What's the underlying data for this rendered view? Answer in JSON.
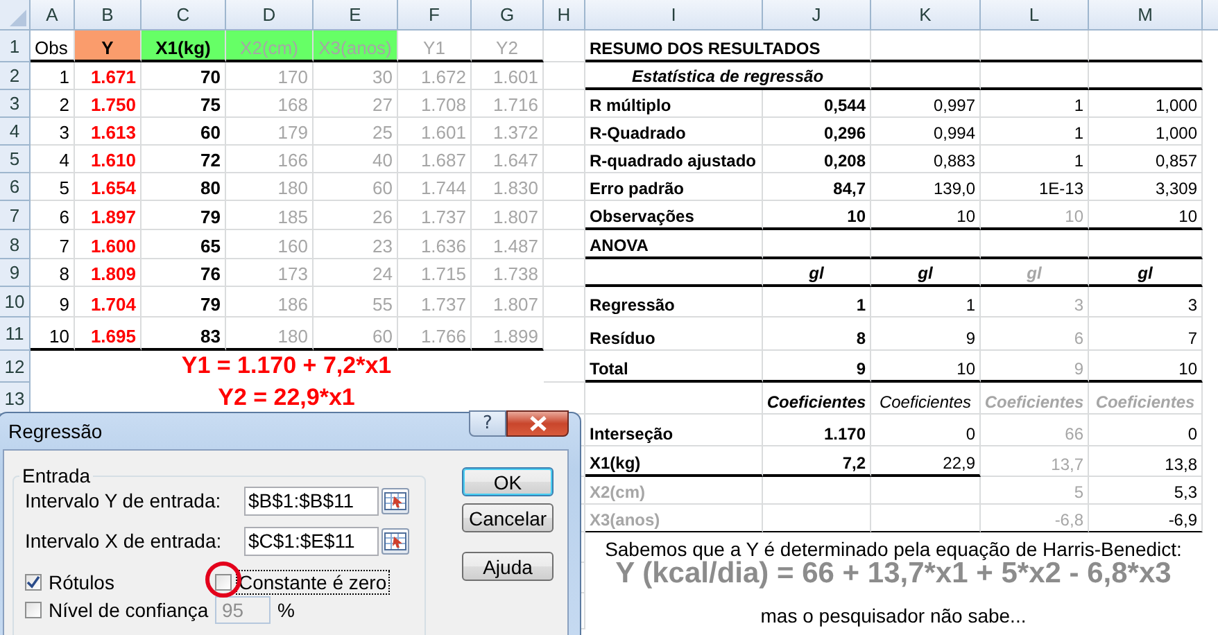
{
  "column_headers": [
    "A",
    "B",
    "C",
    "D",
    "E",
    "F",
    "G",
    "H",
    "I",
    "J",
    "K",
    "L",
    "M"
  ],
  "row_headers": [
    "1",
    "2",
    "3",
    "4",
    "5",
    "6",
    "7",
    "8",
    "9",
    "10",
    "11",
    "12",
    "13"
  ],
  "data_table": {
    "columns": [
      {
        "label": "Obs",
        "bold": false,
        "muted": false,
        "highlighted": false
      },
      {
        "label": "Y",
        "color": "#fa9c6c",
        "bold": true,
        "muted": false,
        "highlighted": true
      },
      {
        "label": "X1(kg)",
        "color": "#66ff66",
        "bold": true,
        "muted": false,
        "highlighted": false
      },
      {
        "label": "X2(cm)",
        "color": "#66ff66",
        "bold": false,
        "muted": true,
        "highlighted": false
      },
      {
        "label": "X3(anos)",
        "color": "#66ff66",
        "bold": false,
        "muted": true,
        "highlighted": false
      },
      {
        "label": "Y1",
        "bold": false,
        "muted": true,
        "highlighted": false
      },
      {
        "label": "Y2",
        "bold": false,
        "muted": true,
        "highlighted": false
      }
    ],
    "rows": [
      [
        "1",
        "1.671",
        "70",
        "170",
        "30",
        "1.672",
        "1.601"
      ],
      [
        "2",
        "1.750",
        "75",
        "168",
        "27",
        "1.708",
        "1.716"
      ],
      [
        "3",
        "1.613",
        "60",
        "179",
        "25",
        "1.601",
        "1.372"
      ],
      [
        "4",
        "1.610",
        "72",
        "166",
        "40",
        "1.687",
        "1.647"
      ],
      [
        "5",
        "1.654",
        "80",
        "180",
        "60",
        "1.744",
        "1.830"
      ],
      [
        "6",
        "1.897",
        "79",
        "185",
        "26",
        "1.737",
        "1.807"
      ],
      [
        "7",
        "1.600",
        "65",
        "160",
        "23",
        "1.636",
        "1.487"
      ],
      [
        "8",
        "1.809",
        "76",
        "173",
        "24",
        "1.715",
        "1.738"
      ],
      [
        "9",
        "1.704",
        "79",
        "186",
        "55",
        "1.737",
        "1.807"
      ],
      [
        "10",
        "1.695",
        "83",
        "180",
        "60",
        "1.766",
        "1.899"
      ]
    ]
  },
  "equations": [
    "Y1 = 1.170 + 7,2*x1",
    "Y2 = 22,9*x1"
  ],
  "summary": {
    "title": "RESUMO DOS RESULTADOS",
    "subtitle": "Estatística de regressão",
    "columns": [
      {
        "bold": true,
        "muted": false
      },
      {
        "bold": false,
        "muted": false
      },
      {
        "bold": false,
        "muted": false
      },
      {
        "bold": false,
        "muted": false
      }
    ],
    "rows": [
      {
        "label": "R múltiplo",
        "values": [
          "0,544",
          "0,997",
          "1",
          "1,000"
        ]
      },
      {
        "label": "R-Quadrado",
        "values": [
          "0,296",
          "0,994",
          "1",
          "1,000"
        ]
      },
      {
        "label": "R-quadrado ajustado",
        "values": [
          "0,208",
          "0,883",
          "1",
          "0,857"
        ]
      },
      {
        "label": "Erro padrão",
        "values": [
          "84,7",
          "139,0",
          "1E-13",
          "3,309"
        ]
      },
      {
        "label": "Observações",
        "values": [
          "10",
          "10",
          "10",
          "10"
        ],
        "columns": [
          {
            "bold": true,
            "muted": false
          },
          {
            "bold": false,
            "muted": false
          },
          {
            "bold": false,
            "muted": true
          },
          {
            "bold": false,
            "muted": false
          }
        ]
      }
    ]
  },
  "anova": {
    "title": "ANOVA",
    "headers": [
      {
        "text": "gl",
        "bold": true,
        "muted": false
      },
      {
        "text": "gl",
        "bold": true,
        "muted": false
      },
      {
        "text": "gl",
        "bold": true,
        "muted": true
      },
      {
        "text": "gl",
        "bold": true,
        "muted": false
      }
    ],
    "columns": [
      {
        "bold": true,
        "muted": false
      },
      {
        "bold": false,
        "muted": false
      },
      {
        "bold": false,
        "muted": true
      },
      {
        "bold": false,
        "muted": false
      }
    ],
    "rows": [
      {
        "label": "Regressão",
        "values": [
          "1",
          "1",
          "3",
          "3"
        ]
      },
      {
        "label": "Resíduo",
        "values": [
          "8",
          "9",
          "6",
          "7"
        ]
      },
      {
        "label": "Total",
        "values": [
          "9",
          "10",
          "9",
          "10"
        ]
      }
    ]
  },
  "coefficients": {
    "headers": [
      {
        "text": "Coeficientes",
        "bold": true,
        "muted": false
      },
      {
        "text": "Coeficientes",
        "bold": false,
        "muted": false
      },
      {
        "text": "Coeficientes",
        "bold": true,
        "muted": true
      },
      {
        "text": "Coeficientes",
        "bold": true,
        "muted": true
      }
    ],
    "columns": [
      {
        "bold": true,
        "muted": false
      },
      {
        "bold": false,
        "muted": false
      },
      {
        "bold": false,
        "muted": true
      },
      {
        "bold": false,
        "muted": false
      }
    ],
    "rows": [
      {
        "label": "Interseção",
        "muted": false,
        "values": [
          "1.170",
          "0",
          "66",
          "0"
        ]
      },
      {
        "label": "X1(kg)",
        "muted": false,
        "values": [
          "7,2",
          "22,9",
          "13,7",
          "13,8"
        ]
      },
      {
        "label": "X2(cm)",
        "muted": true,
        "values": [
          "5",
          "5,3"
        ]
      },
      {
        "label": "X3(anos)",
        "muted": true,
        "values": [
          "-6,8",
          "-6,9"
        ]
      }
    ]
  },
  "notes": [
    {
      "kind": "text",
      "text": "Sabemos que a Y é determinado pela equação de Harris-Benedict:"
    },
    {
      "kind": "formula",
      "text": "Y (kcal/dia) = 66 + 13,7*x1 + 5*x2 - 6,8*x3"
    },
    {
      "kind": "text",
      "text": "mas o pesquisador não sabe..."
    }
  ],
  "dialog": {
    "title": "Regressão",
    "help_button": "?",
    "group": "Entrada",
    "fields": [
      {
        "label": "Intervalo Y de entrada:",
        "value": "$B$1:$B$11"
      },
      {
        "label": "Intervalo X de entrada:",
        "value": "$C$1:$E$11"
      }
    ],
    "checkboxes": [
      {
        "label": "Rótulos",
        "checked": true,
        "focused": false,
        "highlighted": false
      },
      {
        "label": "Constante é zero",
        "checked": false,
        "focused": true,
        "highlighted": true
      },
      {
        "label": "Nível de confiança",
        "checked": false,
        "focused": false,
        "highlighted": false
      }
    ],
    "confidence": {
      "value": "95",
      "unit": "%",
      "disabled": true
    },
    "buttons": [
      {
        "label": "OK",
        "default": true
      },
      {
        "label": "Cancelar",
        "default": false
      },
      {
        "label": "Ajuda",
        "default": false
      }
    ]
  }
}
